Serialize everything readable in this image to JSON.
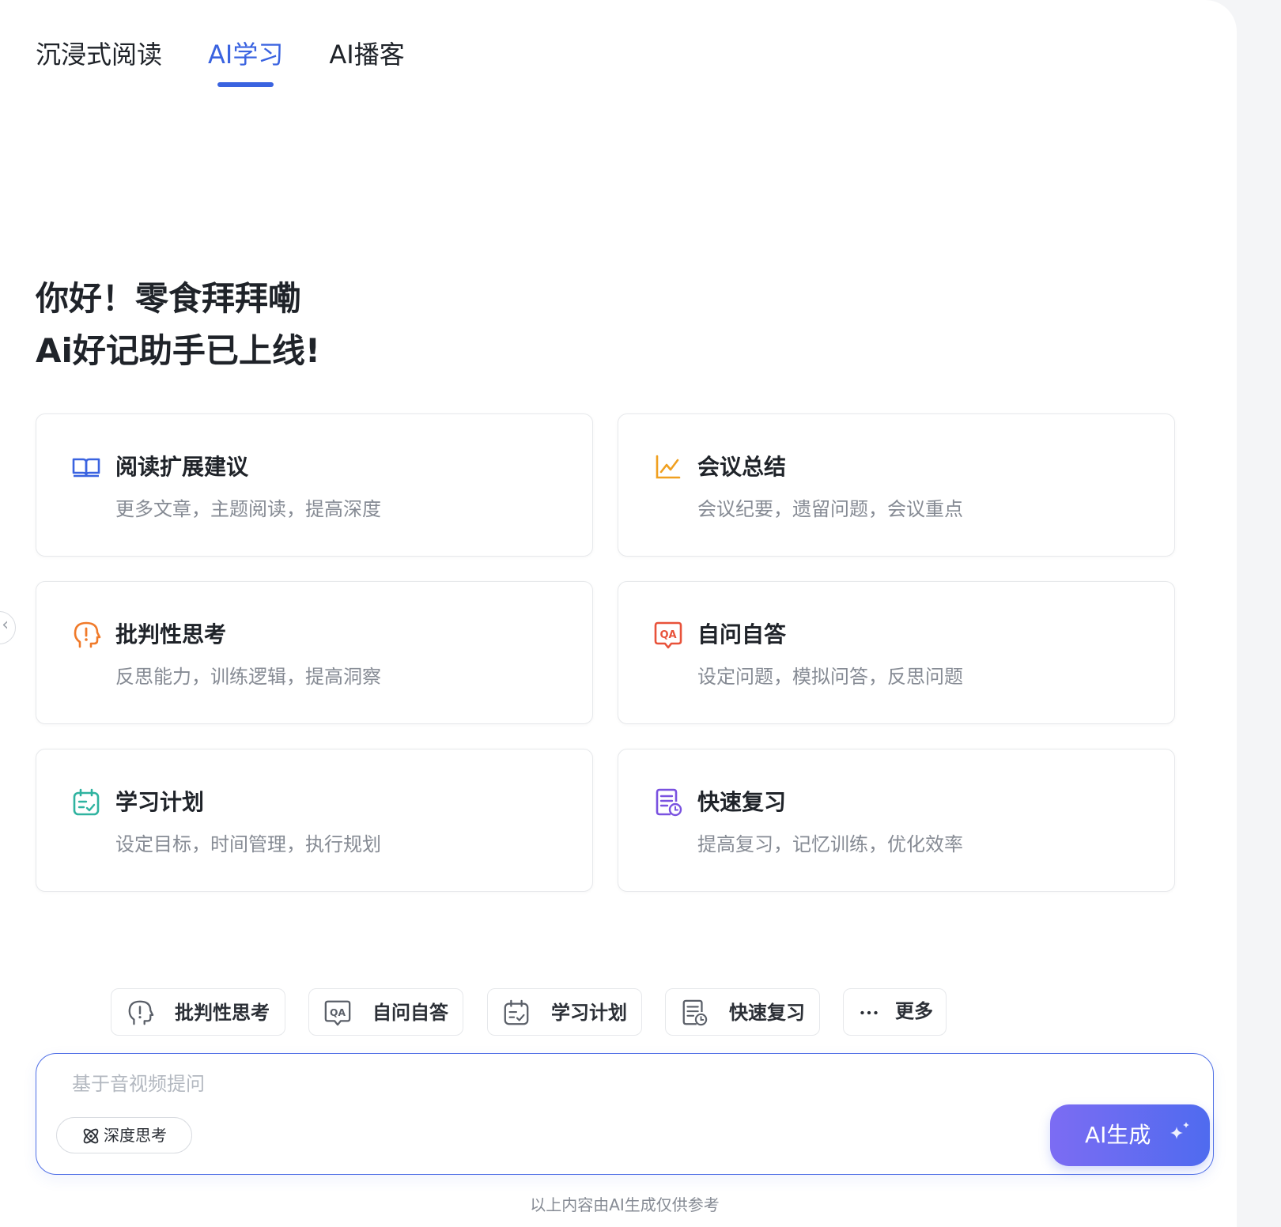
{
  "tabs": [
    {
      "label": "沉浸式阅读",
      "active": false
    },
    {
      "label": "AI学习",
      "active": true
    },
    {
      "label": "AI播客",
      "active": false
    }
  ],
  "greeting": {
    "line1": "你好！零食拜拜嘞",
    "line2": "Ai好记助手已上线!"
  },
  "cards": [
    {
      "title": "阅读扩展建议",
      "desc": "更多文章，主题阅读，提高深度",
      "icon": "book-icon",
      "color": "#3a63e0"
    },
    {
      "title": "会议总结",
      "desc": "会议纪要，遗留问题，会议重点",
      "icon": "chart-line-icon",
      "color": "#f0a020"
    },
    {
      "title": "批判性思考",
      "desc": "反思能力，训练逻辑，提高洞察",
      "icon": "head-exclaim-icon",
      "color": "#f07a2a"
    },
    {
      "title": "自问自答",
      "desc": "设定问题，模拟问答，反思问题",
      "icon": "qa-bubble-icon",
      "color": "#e8523a"
    },
    {
      "title": "学习计划",
      "desc": "设定目标，时间管理，执行规划",
      "icon": "calendar-check-icon",
      "color": "#2fb3a0"
    },
    {
      "title": "快速复习",
      "desc": "提高复习，记忆训练，优化效率",
      "icon": "doc-clock-icon",
      "color": "#7a52e0"
    }
  ],
  "chips": [
    {
      "label": "批判性思考",
      "icon": "head-exclaim-icon"
    },
    {
      "label": "自问自答",
      "icon": "qa-bubble-icon"
    },
    {
      "label": "学习计划",
      "icon": "calendar-check-icon"
    },
    {
      "label": "快速复习",
      "icon": "doc-clock-icon"
    },
    {
      "label": "更多",
      "icon": "more-dots-icon"
    }
  ],
  "input": {
    "placeholder": "基于音视频提问",
    "deep_think_label": "深度思考",
    "generate_label": "AI生成"
  },
  "disclaimer": "以上内容由AI生成仅供参考",
  "colors": {
    "accent": "#3a63e0",
    "button_gradient_start": "#7c6cf3",
    "button_gradient_end": "#4f6bef"
  }
}
